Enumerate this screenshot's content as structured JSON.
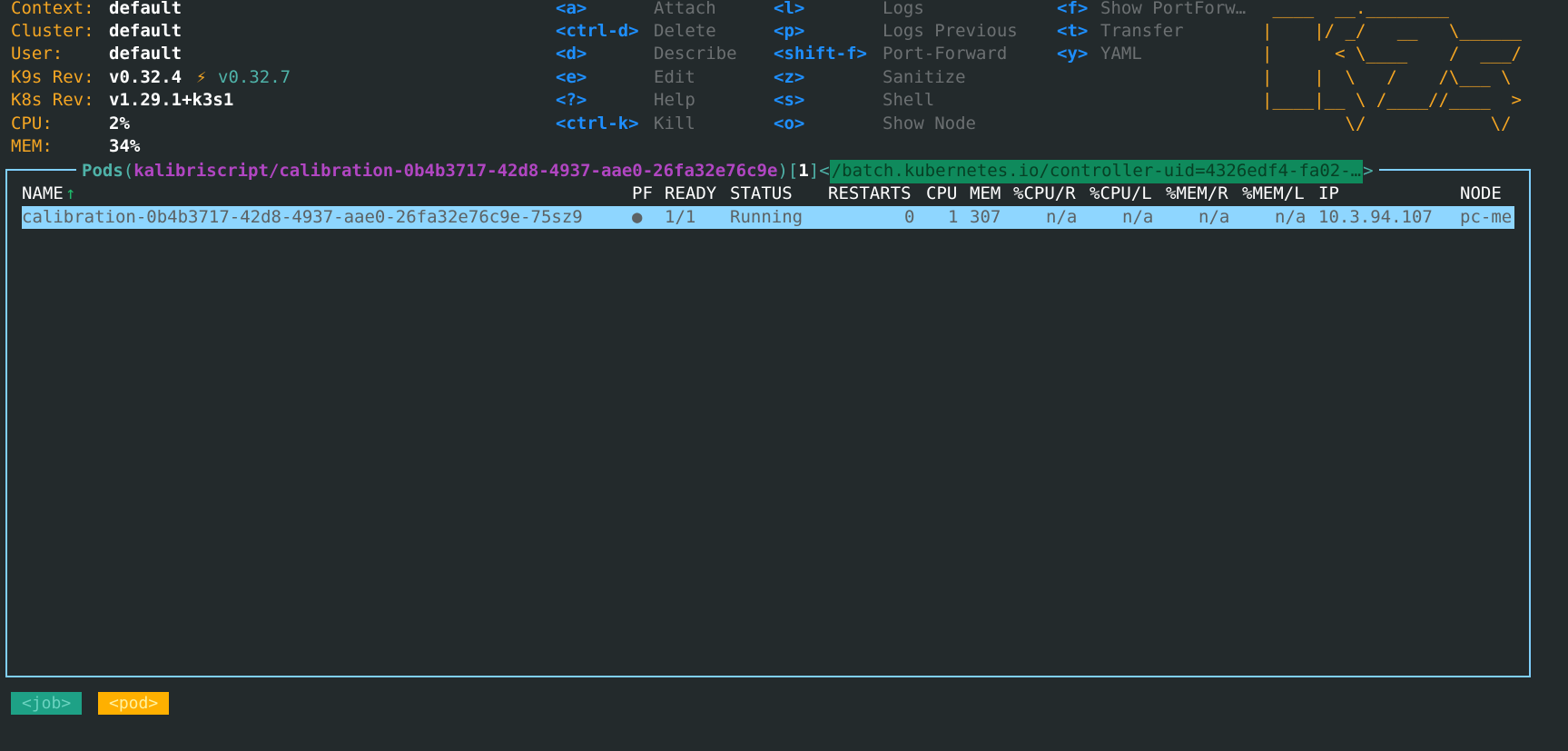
{
  "header": {
    "context_label": "Context:",
    "context_value": "default",
    "cluster_label": "Cluster:",
    "cluster_value": "default",
    "user_label": "User:",
    "user_value": "default",
    "k9s_label": "K9s Rev:",
    "k9s_value": "v0.32.4",
    "k9s_update_icon": "⚡",
    "k9s_update_value": "v0.32.7",
    "k8s_label": "K8s Rev:",
    "k8s_value": "v1.29.1+k3s1",
    "cpu_label": "CPU:",
    "cpu_value": "2%",
    "mem_label": "MEM:",
    "mem_value": "34%"
  },
  "shortcuts": {
    "col1": [
      {
        "key": "<a>",
        "label": "Attach"
      },
      {
        "key": "<ctrl-d>",
        "label": "Delete"
      },
      {
        "key": "<d>",
        "label": "Describe"
      },
      {
        "key": "<e>",
        "label": "Edit"
      },
      {
        "key": "<?>",
        "label": "Help"
      },
      {
        "key": "<ctrl-k>",
        "label": "Kill"
      }
    ],
    "col2": [
      {
        "key": "<l>",
        "label": "Logs"
      },
      {
        "key": "<p>",
        "label": "Logs Previous"
      },
      {
        "key": "<shift-f>",
        "label": "Port-Forward"
      },
      {
        "key": "<z>",
        "label": "Sanitize"
      },
      {
        "key": "<s>",
        "label": "Shell"
      },
      {
        "key": "<o>",
        "label": "Show Node"
      }
    ],
    "col3": [
      {
        "key": "<f>",
        "label": "Show PortForw…"
      },
      {
        "key": "<t>",
        "label": "Transfer"
      },
      {
        "key": "<y>",
        "label": "YAML"
      }
    ]
  },
  "logo": {
    "lines": [
      " ____  __.________       ",
      "|    |/ _/   __   \\______",
      "|      < \\____    /  ___/",
      "|    |  \\   /    /\\___ \\ ",
      "|____|__ \\ /____//____  >",
      "        \\/            \\/ "
    ]
  },
  "view": {
    "resource": "Pods",
    "open_paren": "(",
    "namespace": "kalibriscript/calibration-0b4b3717-42d8-4937-aae0-26fa32e76c9e",
    "close_paren": ")",
    "open_bracket": "[",
    "count": "1",
    "close_bracket": "]",
    "filter_lt": "<",
    "filter": "/batch.kubernetes.io/controller-uid=4326edf4-fa02-…",
    "filter_gt": ">"
  },
  "table": {
    "headers": {
      "name": "NAME",
      "sort": "↑",
      "pf": "PF",
      "ready": "READY",
      "status": "STATUS",
      "restarts": "RESTARTS",
      "cpu": "CPU",
      "mem": "MEM",
      "cpu_r": "%CPU/R",
      "cpu_l": "%CPU/L",
      "mem_r": "%MEM/R",
      "mem_l": "%MEM/L",
      "ip": "IP",
      "node": "NODE"
    },
    "rows": [
      {
        "name": "calibration-0b4b3717-42d8-4937-aae0-26fa32e76c9e-75sz9",
        "pf": "●",
        "ready": "1/1",
        "status": "Running",
        "restarts": "0",
        "cpu": "1",
        "mem": "307",
        "cpu_r": "n/a",
        "cpu_l": "n/a",
        "mem_r": "n/a",
        "mem_l": "n/a",
        "ip": "10.3.94.107",
        "node": "pc-me"
      }
    ]
  },
  "breadcrumbs": [
    {
      "label": "<job>",
      "color": "#1ea186"
    },
    {
      "label": "<pod>",
      "color": "#ffb000"
    }
  ]
}
